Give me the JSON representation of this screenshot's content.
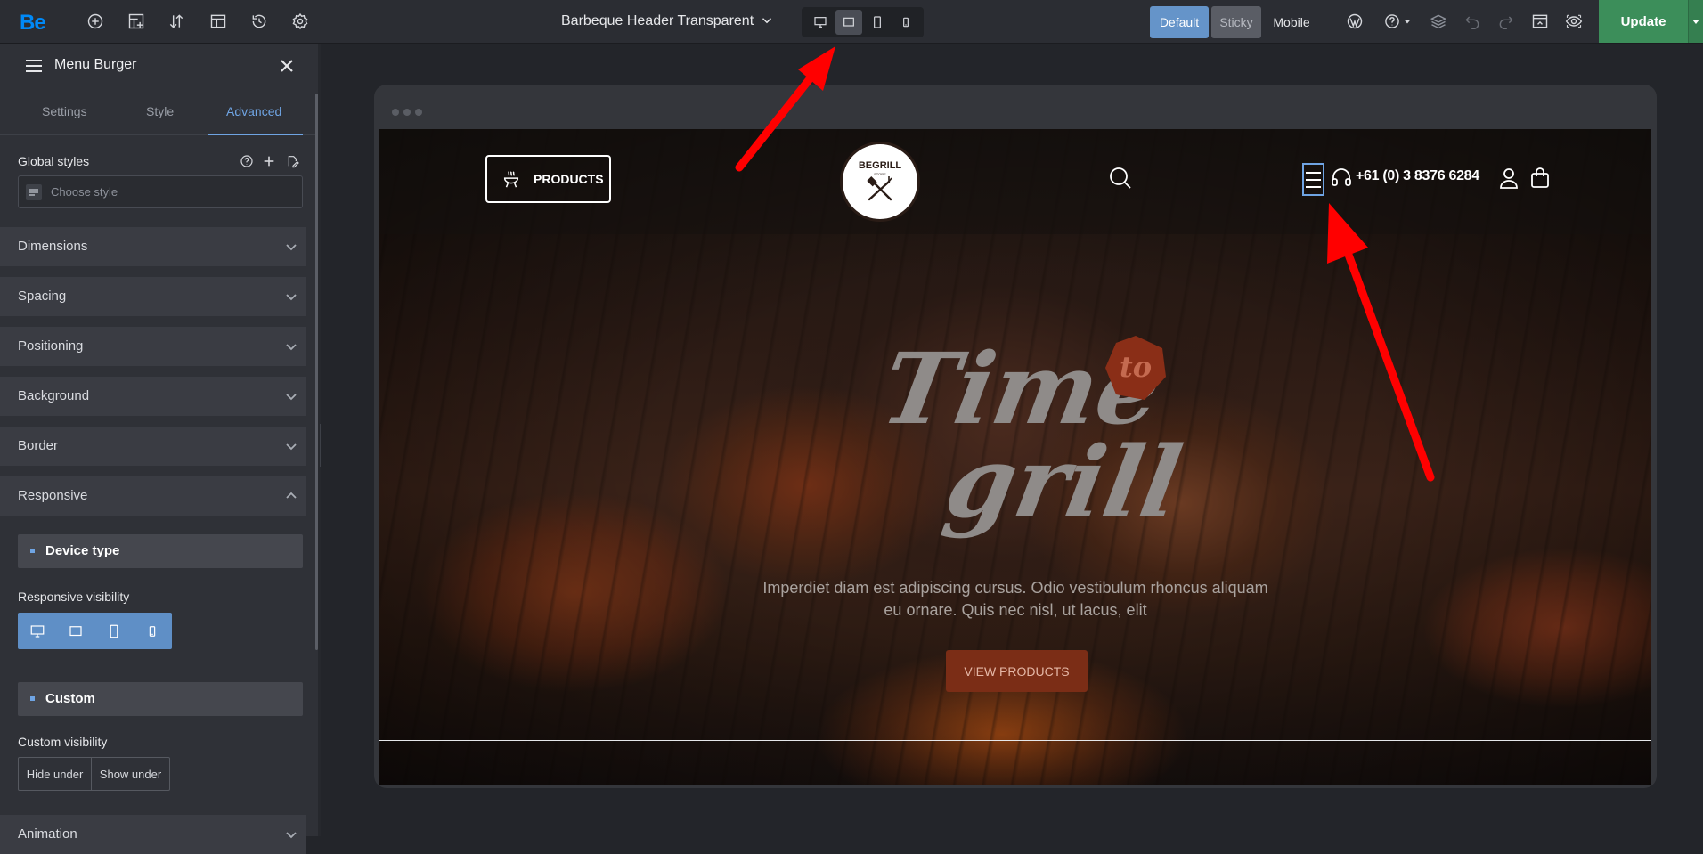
{
  "topbar": {
    "logo": "Be",
    "document_title": "Barbeque Header Transparent",
    "icons": [
      "add-icon",
      "navigator-icon",
      "sort-icon",
      "layout-icon",
      "history-icon",
      "settings-icon"
    ],
    "device_buttons": [
      "desktop",
      "laptop",
      "tablet",
      "mobile"
    ],
    "active_device": "laptop",
    "modes": {
      "default": "Default",
      "sticky": "Sticky",
      "mobile": "Mobile"
    },
    "active_mode": "Default",
    "update_label": "Update"
  },
  "sidebar": {
    "title": "Menu Burger",
    "tabs": [
      "Settings",
      "Style",
      "Advanced"
    ],
    "active_tab": "Advanced",
    "global_styles": {
      "label": "Global styles",
      "placeholder": "Choose style"
    },
    "accordions": [
      "Dimensions",
      "Spacing",
      "Positioning",
      "Background",
      "Border",
      "Responsive",
      "Animation"
    ],
    "open_accordion": "Responsive",
    "responsive": {
      "device_type_label": "Device type",
      "visibility_label": "Responsive visibility",
      "visibility_devices": [
        "desktop",
        "laptop",
        "tablet",
        "mobile"
      ],
      "custom_label": "Custom",
      "custom_visibility_label": "Custom visibility",
      "hide_under": "Hide under",
      "show_under": "Show under"
    }
  },
  "preview": {
    "products_button": "PRODUCTS",
    "logo_text": "BEGRILL",
    "logo_subtext": "STORE",
    "phone": "+61 (0) 3 8376 6284",
    "hero_title_line1": "Time",
    "hero_title_line2": "grill",
    "hero_badge": "to",
    "hero_text_line1": "Imperdiet diam est adipiscing cursus. Odio vestibulum rhoncus aliquam",
    "hero_text_line2": "eu ornare. Quis nec nisl, ut lacus, elit",
    "hero_button": "VIEW PRODUCTS"
  },
  "colors": {
    "accent": "#6fa4e3",
    "update": "#3c8e5a",
    "hero_button": "#7b2d16",
    "annotation_arrow": "#ff0000"
  }
}
